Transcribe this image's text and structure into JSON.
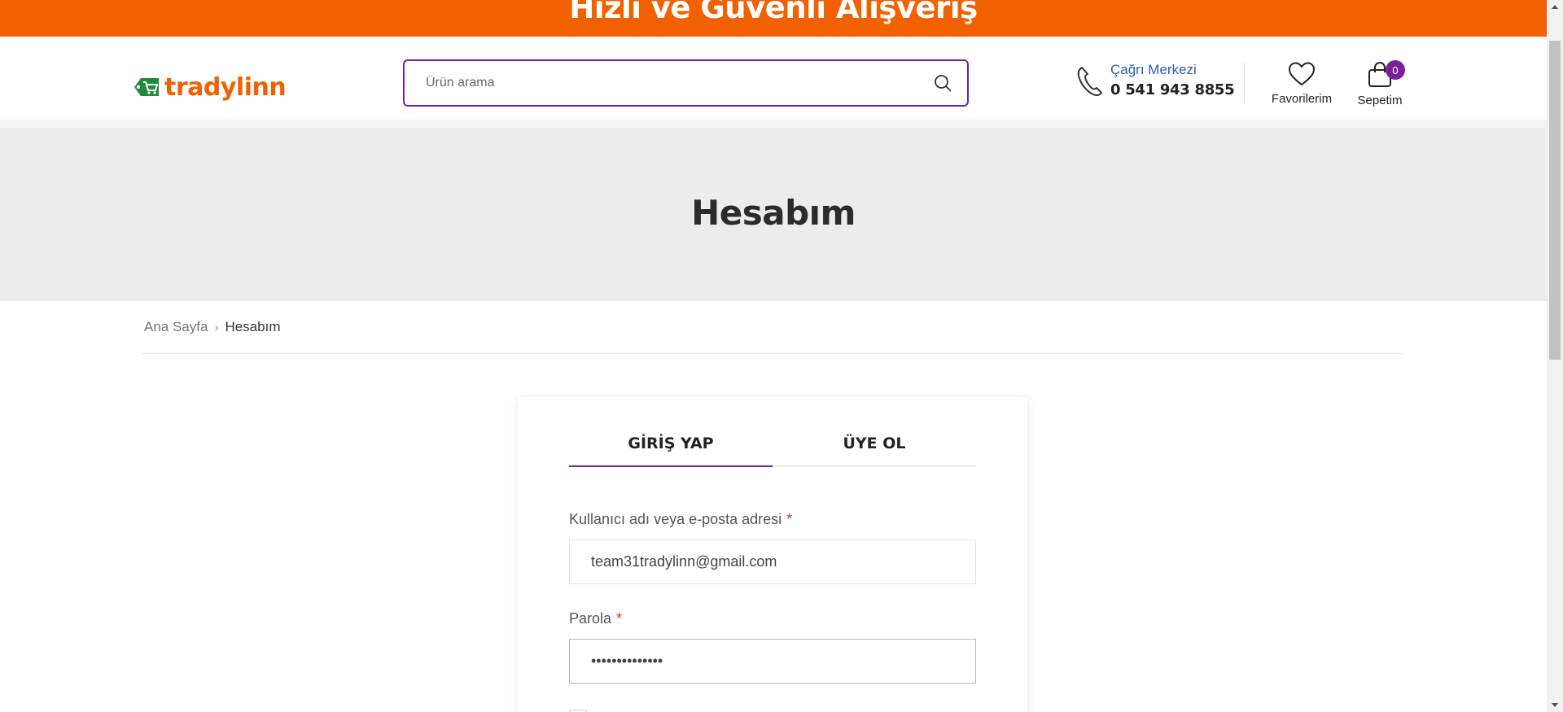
{
  "promo": {
    "text": "Hızlı ve Güvenli Alışveriş"
  },
  "header": {
    "logo_text": "tradylinn",
    "search_placeholder": "Ürün arama",
    "call_center": {
      "title": "Çağrı Merkezi",
      "phone": "0 541 943 8855"
    },
    "favorites_label": "Favorilerim",
    "cart": {
      "label": "Sepetim",
      "count": "0"
    }
  },
  "page": {
    "title": "Hesabım"
  },
  "breadcrumb": {
    "home": "Ana Sayfa",
    "current": "Hesabım"
  },
  "login": {
    "tabs": [
      {
        "label": "GİRİŞ YAP",
        "active": true
      },
      {
        "label": "ÜYE OL",
        "active": false
      }
    ],
    "username_label": "Kullanıcı adı veya e-posta adresi",
    "username_value": "team31tradylinn@gmail.com",
    "password_label": "Parola",
    "password_value": "••••••••••••••",
    "required_mark": "*"
  },
  "colors": {
    "brand_orange": "#f26100",
    "accent_purple": "#7a1f9c",
    "brand_green": "#1f8a3b",
    "link_blue": "#2d5ea8"
  },
  "icons": [
    "logo-cart-icon",
    "search-icon",
    "phone-icon",
    "heart-icon",
    "shopping-bag-icon"
  ]
}
